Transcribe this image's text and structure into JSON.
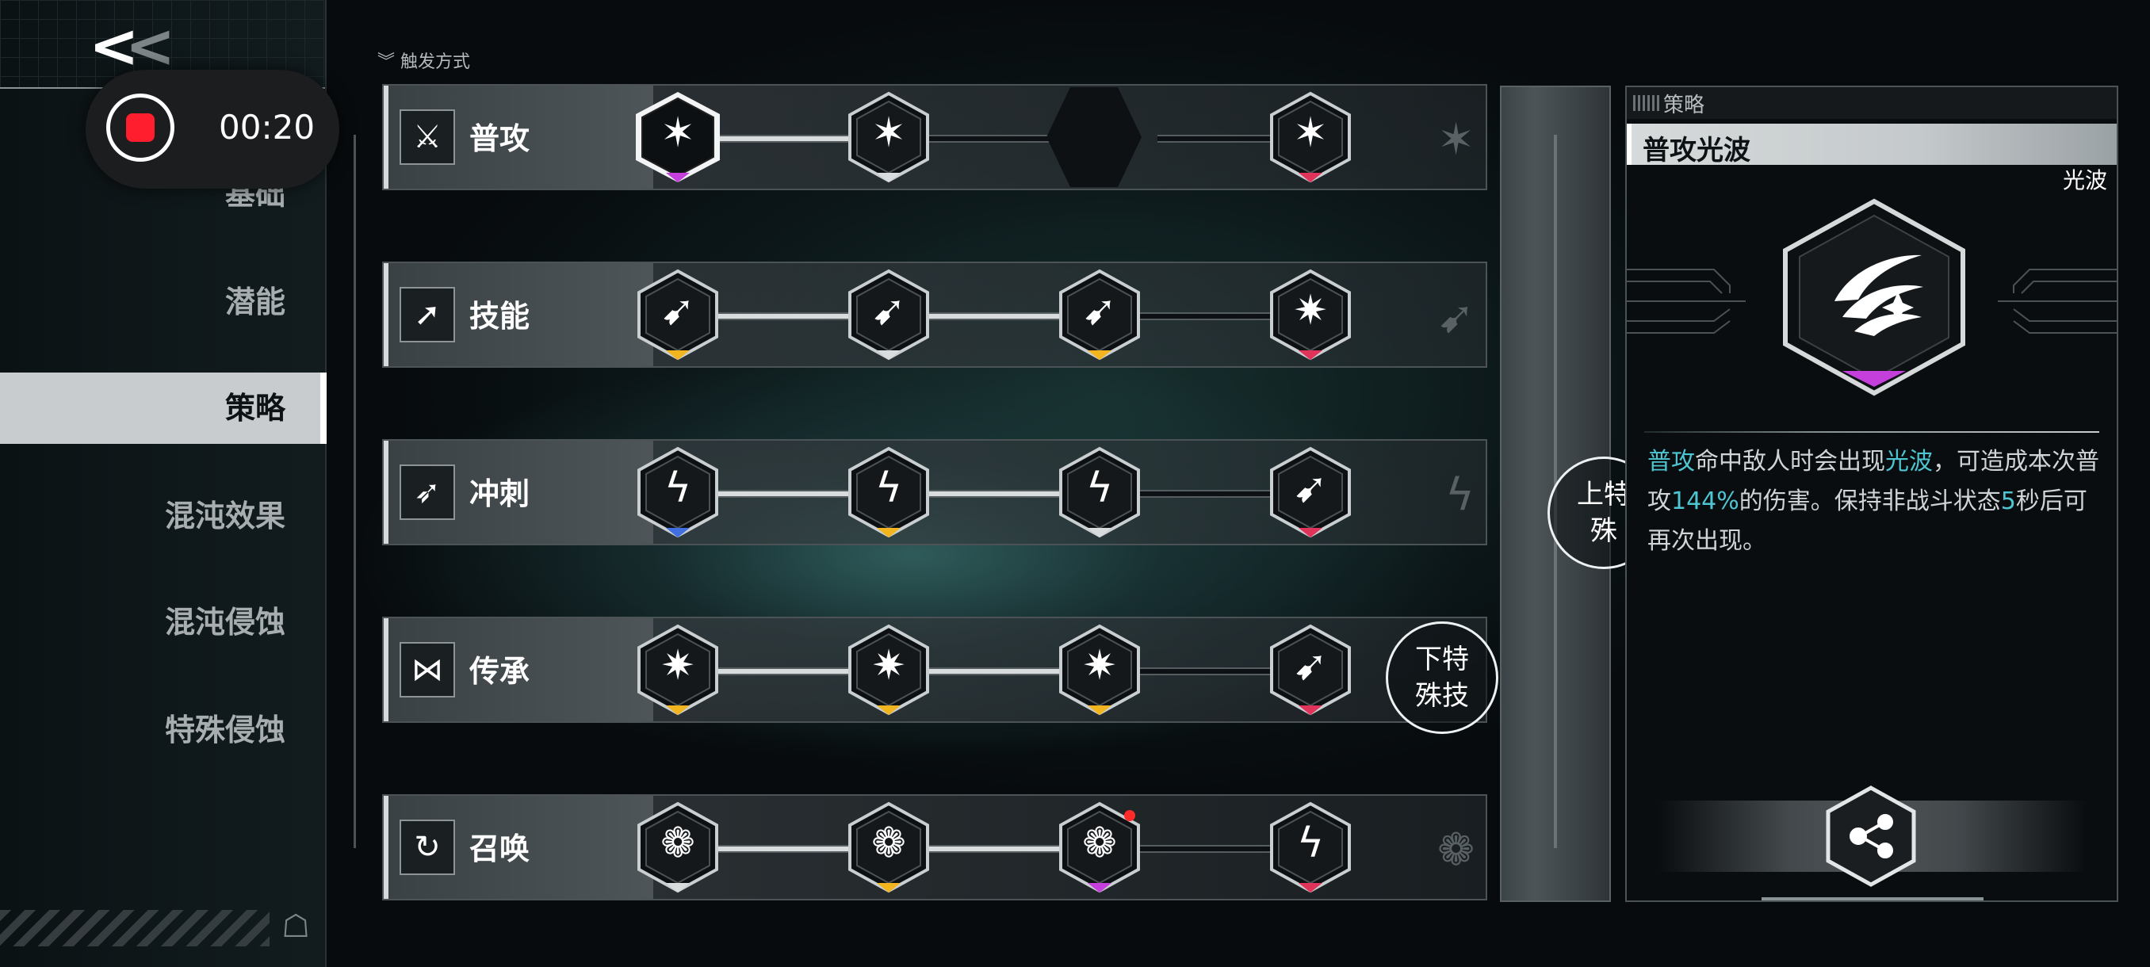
{
  "sidebar": {
    "back_label": "<<",
    "recording_time": "00:20",
    "items": [
      {
        "label": "基础",
        "active": false
      },
      {
        "label": "潜能",
        "active": false
      },
      {
        "label": "策略",
        "active": true
      },
      {
        "label": "混沌效果",
        "active": false
      },
      {
        "label": "混沌侵蚀",
        "active": false
      },
      {
        "label": "特殊侵蚀",
        "active": false
      }
    ]
  },
  "trigger_label": "触发方式",
  "rows": [
    {
      "label": "普攻",
      "icon": "crossed-swords-icon"
    },
    {
      "label": "技能",
      "icon": "arrow-strike-icon"
    },
    {
      "label": "冲刺",
      "icon": "dash-icon"
    },
    {
      "label": "传承",
      "icon": "dna-icon"
    },
    {
      "label": "召唤",
      "icon": "summon-icon"
    }
  ],
  "colors": {
    "purple": "#c43fdc",
    "pink": "#e0335a",
    "yellow": "#f2b51f",
    "white": "#d9dcdd",
    "blue": "#3f6fe0",
    "highlight": "#4ec6d2"
  },
  "bubbles": {
    "upper": "上特\n殊",
    "lower": "下特\n殊技"
  },
  "panel": {
    "category": "策略",
    "title": "普攻光波",
    "tag": "光波",
    "desc_parts": [
      {
        "text": "普攻",
        "hl": true
      },
      {
        "text": "命中敌人时会出现",
        "hl": false
      },
      {
        "text": "光波",
        "hl": true
      },
      {
        "text": "，可造成本次普攻",
        "hl": false
      },
      {
        "text": "144%",
        "hl": true
      },
      {
        "text": "的伤害。保持非战斗状态",
        "hl": false
      },
      {
        "text": "5",
        "hl": true
      },
      {
        "text": "秒后可再次出现。",
        "hl": false
      }
    ]
  }
}
